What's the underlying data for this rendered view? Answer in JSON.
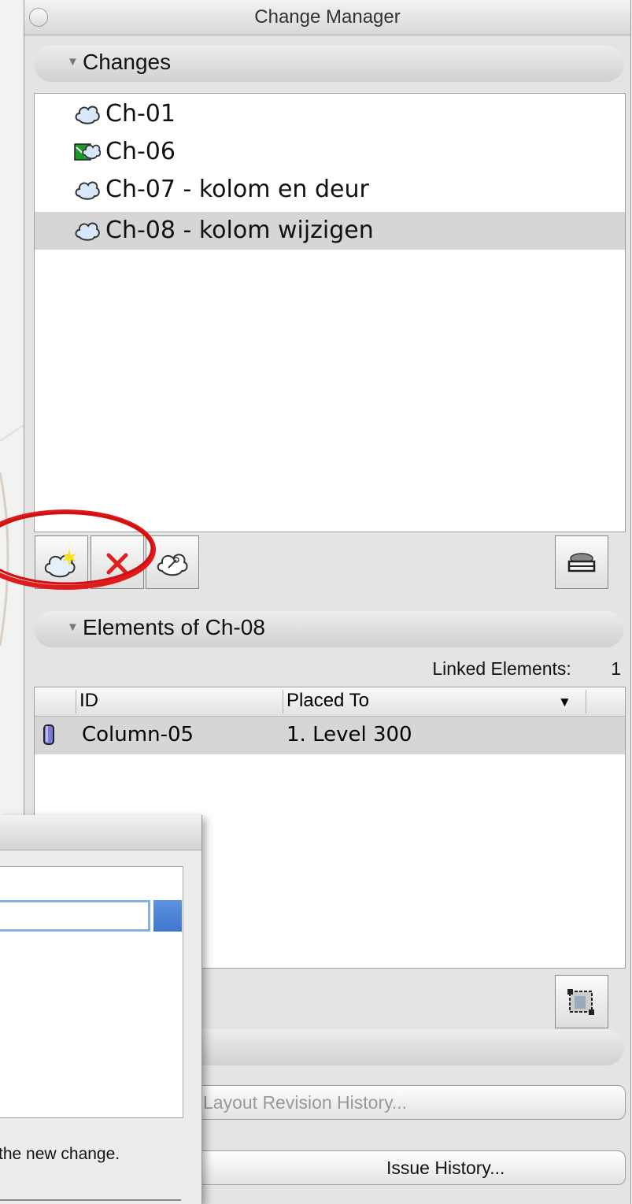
{
  "palette": {
    "title": "Change Manager"
  },
  "changes_section": {
    "label": "Changes"
  },
  "changes": [
    {
      "label": "Ch-01",
      "icon": "cloud-icon",
      "selected": false
    },
    {
      "label": "Ch-06",
      "icon": "cloud-issued-icon",
      "selected": false
    },
    {
      "label": "Ch-07 - kolom en deur",
      "icon": "cloud-icon",
      "selected": false
    },
    {
      "label": "Ch-08 - kolom wijzigen",
      "icon": "cloud-icon",
      "selected": true
    }
  ],
  "elements_section": {
    "label": "Elements of Ch-08"
  },
  "linked": {
    "label": "Linked Elements:",
    "count": "1"
  },
  "elements_table": {
    "headers": {
      "id": "ID",
      "placed_to": "Placed To"
    },
    "rows": [
      {
        "id": "Column-05",
        "placed_to": "1. Level 300"
      }
    ]
  },
  "buttons": {
    "layout_history": "Layout Revision History...",
    "issue_history": "Issue History..."
  },
  "dialog": {
    "note": "the new change."
  },
  "colors": {
    "selection": "#d6d6d6",
    "accent_blue": "#3f76cf",
    "annotation": "#e01b1b",
    "delete": "#e02020"
  }
}
